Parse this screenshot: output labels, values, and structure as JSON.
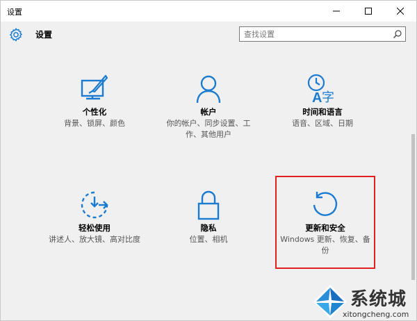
{
  "window": {
    "title": "设置"
  },
  "titlebar_buttons": [
    {
      "name": "minimize-button",
      "icon": "minimize-icon"
    },
    {
      "name": "maximize-button",
      "icon": "maximize-icon"
    },
    {
      "name": "close-button",
      "icon": "close-icon"
    }
  ],
  "header": {
    "icon": "gear-icon",
    "title": "设置"
  },
  "search": {
    "placeholder": "查找设置",
    "value": "",
    "icon": "search-icon"
  },
  "tiles": [
    {
      "label": "个性化",
      "desc": "背景、锁屏、颜色",
      "icon": "personalization-icon"
    },
    {
      "label": "帐户",
      "desc": "你的帐户、同步设置、工作、其他用户",
      "icon": "accounts-icon"
    },
    {
      "label": "时间和语言",
      "desc": "语音、区域、日期",
      "icon": "time-language-icon"
    },
    {
      "label": "轻松使用",
      "desc": "讲述人、放大镜、高对比度",
      "icon": "ease-of-access-icon"
    },
    {
      "label": "隐私",
      "desc": "位置、相机",
      "icon": "privacy-lock-icon"
    },
    {
      "label": "更新和安全",
      "desc": "Windows 更新、恢复、备份",
      "icon": "update-security-icon"
    }
  ],
  "watermark": {
    "brand": "系统城",
    "url": "xitongcheng.com"
  },
  "colors": {
    "accent": "#1a7bd0",
    "highlight": "#e02020"
  }
}
